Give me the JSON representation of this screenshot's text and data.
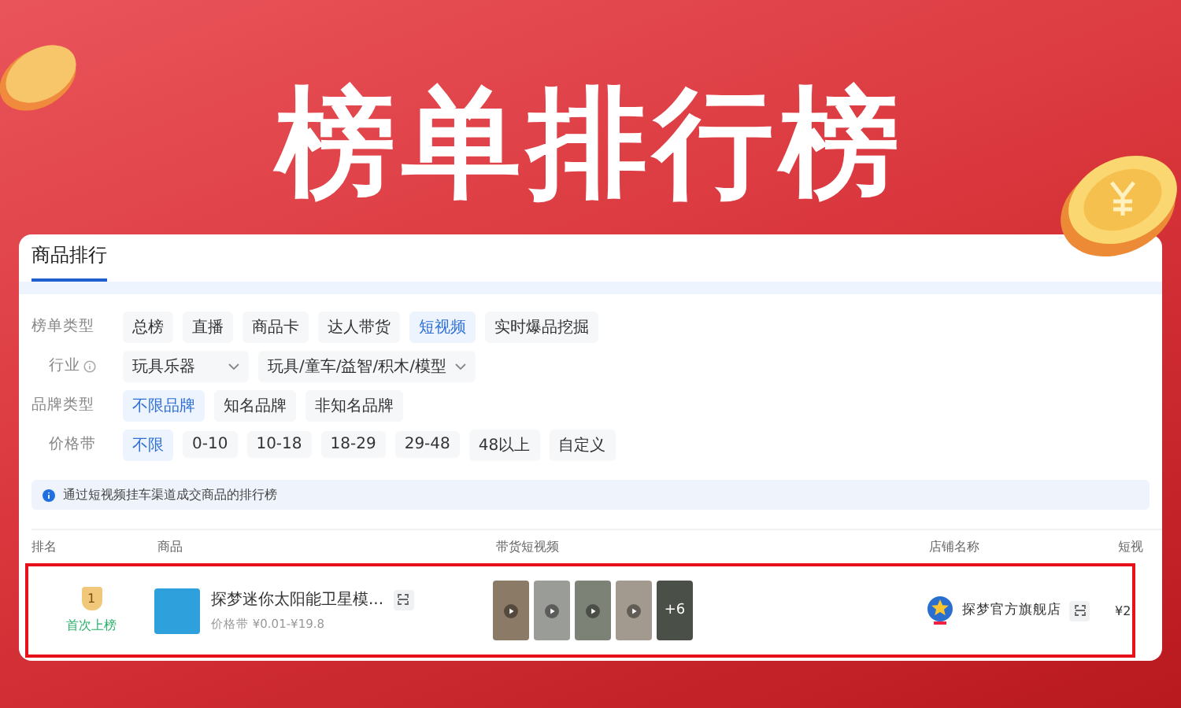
{
  "banner": {
    "title": "榜单排行榜"
  },
  "panel": {
    "tabs": [
      {
        "label": "商品排行",
        "selected": true
      }
    ],
    "filters": [
      {
        "kind": "chips",
        "label": "榜单类型",
        "options": [
          {
            "label": "总榜",
            "selected": false
          },
          {
            "label": "直播",
            "selected": false
          },
          {
            "label": "商品卡",
            "selected": false
          },
          {
            "label": "达人带货",
            "selected": false
          },
          {
            "label": "短视频",
            "selected": true
          },
          {
            "label": "实时爆品挖掘",
            "selected": false
          }
        ]
      },
      {
        "kind": "dropdowns",
        "label": "行业",
        "dropdowns": [
          {
            "value": "玩具乐器"
          },
          {
            "value": "玩具/童车/益智/积木/模型"
          }
        ]
      },
      {
        "kind": "chips",
        "label": "品牌类型",
        "options": [
          {
            "label": "不限品牌",
            "selected": true
          },
          {
            "label": "知名品牌",
            "selected": false
          },
          {
            "label": "非知名品牌",
            "selected": false
          }
        ]
      },
      {
        "kind": "chips",
        "label": "价格带",
        "options": [
          {
            "label": "不限",
            "selected": true
          },
          {
            "label": "0-10",
            "selected": false
          },
          {
            "label": "10-18",
            "selected": false
          },
          {
            "label": "18-29",
            "selected": false
          },
          {
            "label": "29-48",
            "selected": false
          },
          {
            "label": "48以上",
            "selected": false
          },
          {
            "label": "自定义",
            "selected": false
          }
        ]
      }
    ],
    "notice": "通过短视频挂车渠道成交商品的排行榜",
    "table": {
      "columns": [
        "排名",
        "商品",
        "带货短视频",
        "店铺名称",
        "短视"
      ],
      "rows": [
        {
          "rank": "1",
          "rank_note": "首次上榜",
          "product": "探梦迷你太阳能卫星模...",
          "price": "价格带 ¥0.01-¥19.8",
          "videos_more": "+6",
          "shop": "探梦官方旗舰店",
          "column_5": "¥2",
          "highlighted": true
        }
      ]
    }
  }
}
